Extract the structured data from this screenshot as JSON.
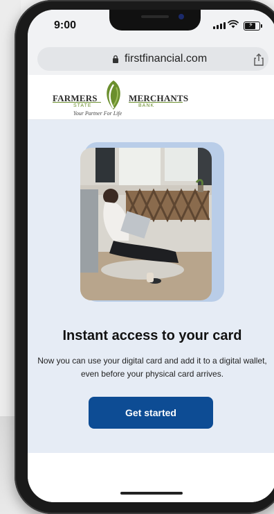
{
  "status_bar": {
    "time": "9:00"
  },
  "browser": {
    "url": "firstfinancial.com"
  },
  "brand": {
    "logo_left": "FARMERS",
    "logo_right": "MERCHANTS",
    "logo_sub_left": "STATE",
    "logo_sub_right": "BANK",
    "tagline": "Your Partner For Life"
  },
  "main": {
    "headline": "Instant access to your card",
    "body": "Now you can use your digital card and add it to a digital wallet, even before your physical card arrives.",
    "cta_label": "Get started"
  },
  "colors": {
    "cta": "#0d4c94",
    "content_bg": "#e6ecf5",
    "logo_green": "#6b8f2e",
    "photo_frame": "#b9cde8"
  }
}
